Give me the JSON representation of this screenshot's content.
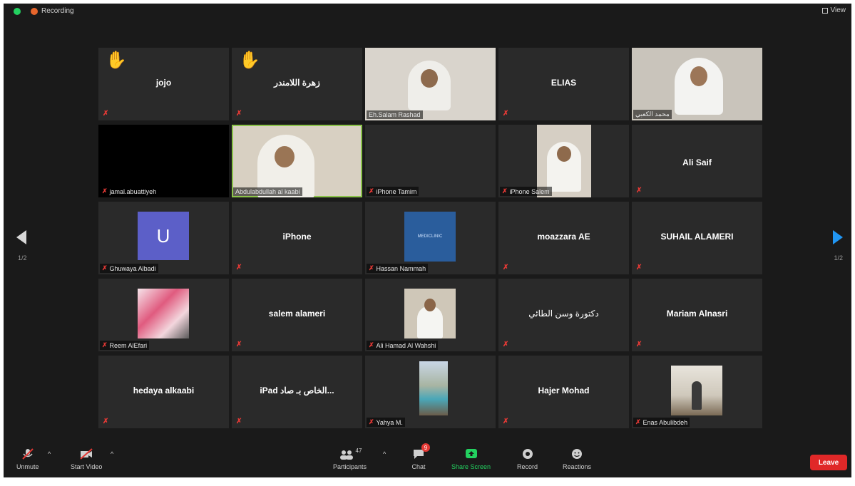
{
  "top_bar": {
    "recording_label": "Recording",
    "view_label": "View"
  },
  "pagination": {
    "left": "1/2",
    "right": "1/2"
  },
  "tiles": [
    {
      "name": "jojo",
      "hand": "✋"
    },
    {
      "name": "زهرة اللامندر",
      "hand": "✋"
    },
    {
      "label": "Eh.Salam Rashad"
    },
    {
      "name": "ELIAS"
    },
    {
      "label": "محمد الكعبي"
    },
    {
      "label": "jamal.abuattiyeh"
    },
    {
      "label": "Abdulabdullah al kaabi"
    },
    {
      "label": "iPhone Tamim"
    },
    {
      "label": "iPhone Salem"
    },
    {
      "name": "Ali Saif"
    },
    {
      "label": "Ghuwaya Albadi",
      "avatar_letter": "U"
    },
    {
      "name": "iPhone"
    },
    {
      "label": "Hassan Nammah",
      "logo_text": "MEDICLINIC"
    },
    {
      "name": "moazzara AE"
    },
    {
      "name": "SUHAIL ALAMERI"
    },
    {
      "label": "Reem AlEfari"
    },
    {
      "name": "salem alameri"
    },
    {
      "label": "Ali Hamad Al Wahshi"
    },
    {
      "name": "دكتورة وسن الطائي"
    },
    {
      "name": "Mariam Alnasri"
    },
    {
      "name": "hedaya alkaabi"
    },
    {
      "name": "iPad الخاص بـ صاد..."
    },
    {
      "label": "Yahya M."
    },
    {
      "name": "Hajer Mohad"
    },
    {
      "label": "Enas Abulibdeh"
    }
  ],
  "toolbar": {
    "unmute": "Unmute",
    "start_video": "Start Video",
    "participants": "Participants",
    "participants_count": "47",
    "chat": "Chat",
    "chat_badge": "9",
    "share_screen": "Share Screen",
    "record": "Record",
    "reactions": "Reactions",
    "leave": "Leave"
  },
  "colors": {
    "accent_green": "#23d160",
    "leave_red": "#e02828",
    "muted_red": "#e53935",
    "active_border": "#8bc34a",
    "avatar_purple": "#5c5fc8",
    "nav_blue": "#2196f3"
  }
}
